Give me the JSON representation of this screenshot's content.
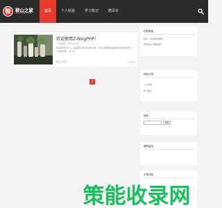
{
  "header": {
    "logo_badge": "鞍",
    "logo_title": "鞍山之家",
    "logo_subtitle": "www.anshanzj.com",
    "nav": [
      "首页",
      "个人经验",
      "学习笔记",
      "酷百本"
    ]
  },
  "post": {
    "title": "欢迎使用Z-BlogPHP！",
    "meta": "个人经验 • 2024-11-17",
    "excerpt": "欢迎使用Z-Blog，这是程序自动生成的文章，您可以删除或是编辑它在系统生成了一个留言卡你 • 第 1次 ...",
    "tag": "酷百工作室",
    "stats": "□ 0  ◉ 0"
  },
  "pagination": {
    "current": "1"
  },
  "sidebar": {
    "control_panel": {
      "title": "控制面板",
      "line1": "您好，欢迎到访网站！",
      "line2": "登录后台 查看权限"
    },
    "categories": {
      "title": "网站分类",
      "items": [
        "个人经验",
        "学习笔记"
      ]
    },
    "search": {
      "title": "搜索",
      "input_value": "",
      "button_label": "搜索"
    },
    "latest": {
      "title": "最新留言"
    },
    "archive": {
      "title": "文章归档"
    }
  },
  "watermark": {
    "text": "策能收录网"
  },
  "colors": {
    "accent": "#e8392d",
    "header": "#2b2b2b",
    "background": "#f3f3f3"
  }
}
